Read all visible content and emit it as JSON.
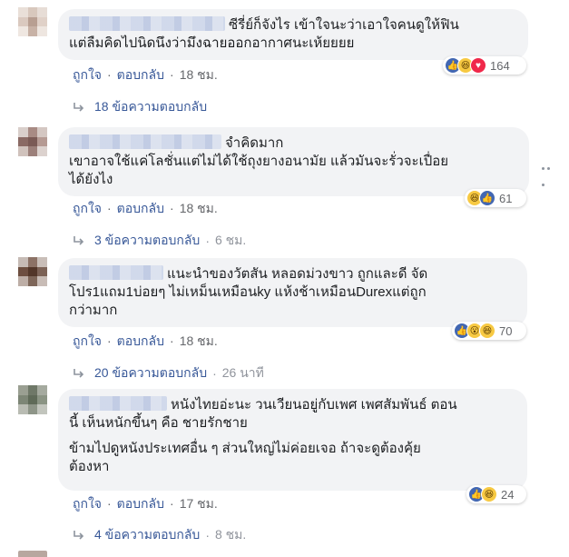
{
  "comments": [
    {
      "line1_suffix": "ซีรี่ย์ก็จังไร เข้าใจนะว่าเอาใจคนดูให้ฟิน",
      "line2": "แต่ลืมคิดไปนิดนึงว่ามึงฉายออกอากาศนะเห้ยยยย",
      "reaction_count": "164",
      "reaction_icons": [
        "like-reaction-icon",
        "haha-reaction-icon",
        "love-reaction-icon"
      ],
      "like_label": "ถูกใจ",
      "reply_label": "ตอบกลับ",
      "time": "18 ชม.",
      "replies_label": "18 ข้อความตอบกลับ",
      "replies_time": ""
    },
    {
      "line1_suffix": "จำคิดมาก",
      "line2": "เขาอาจใช้แค่โลชั่นแต่ไม่ได้ใช้ถุงยางอนามัย แล้วมันจะรั่วจะเปื่อย",
      "line3": "ได้ยังไง",
      "reaction_count": "61",
      "reaction_icons": [
        "haha-reaction-icon",
        "like-reaction-icon"
      ],
      "like_label": "ถูกใจ",
      "reply_label": "ตอบกลับ",
      "time": "18 ชม.",
      "replies_label": "3 ข้อความตอบกลับ",
      "replies_time": "6 ชม."
    },
    {
      "line1_suffix": "แนะนำของวัตสัน หลอดม่วงขาว ถูกและดี จัด",
      "line2": "โปร1แถม1บ่อยๆ ไม่เหม็นเหมือนky แห้งช้าเหมือนDurexแต่ถูก",
      "line3": "กว่ามาก",
      "reaction_count": "70",
      "reaction_icons": [
        "like-reaction-icon",
        "wow-reaction-icon",
        "haha-reaction-icon"
      ],
      "like_label": "ถูกใจ",
      "reply_label": "ตอบกลับ",
      "time": "18 ชม.",
      "replies_label": "20 ข้อความตอบกลับ",
      "replies_time": "26 นาที"
    },
    {
      "line1_suffix": "หนังไทยอ่ะนะ วนเวียนอยู่กับเพศ เพศสัมพันธ์ ตอน",
      "line2": "นี้ เห็นหนักขึ้นๆ คือ ชายรักชาย",
      "para2_line1": "ข้ามไปดูหนังประเทศอื่น ๆ ส่วนใหญ่ไม่ค่อยเจอ ถ้าจะดูต้องคุ้ย",
      "para2_line2": "ต้องหา",
      "reaction_count": "24",
      "reaction_icons": [
        "like-reaction-icon",
        "haha-reaction-icon"
      ],
      "like_label": "ถูกใจ",
      "reply_label": "ตอบกลับ",
      "time": "17 ชม.",
      "replies_label": "4 ข้อความตอบกลับ",
      "replies_time": "8 ชม."
    }
  ],
  "colors": {
    "link": "#385898",
    "bubble": "#f2f3f5",
    "like": "#4267b2",
    "haha": "#f7c942",
    "love": "#f0284a"
  }
}
